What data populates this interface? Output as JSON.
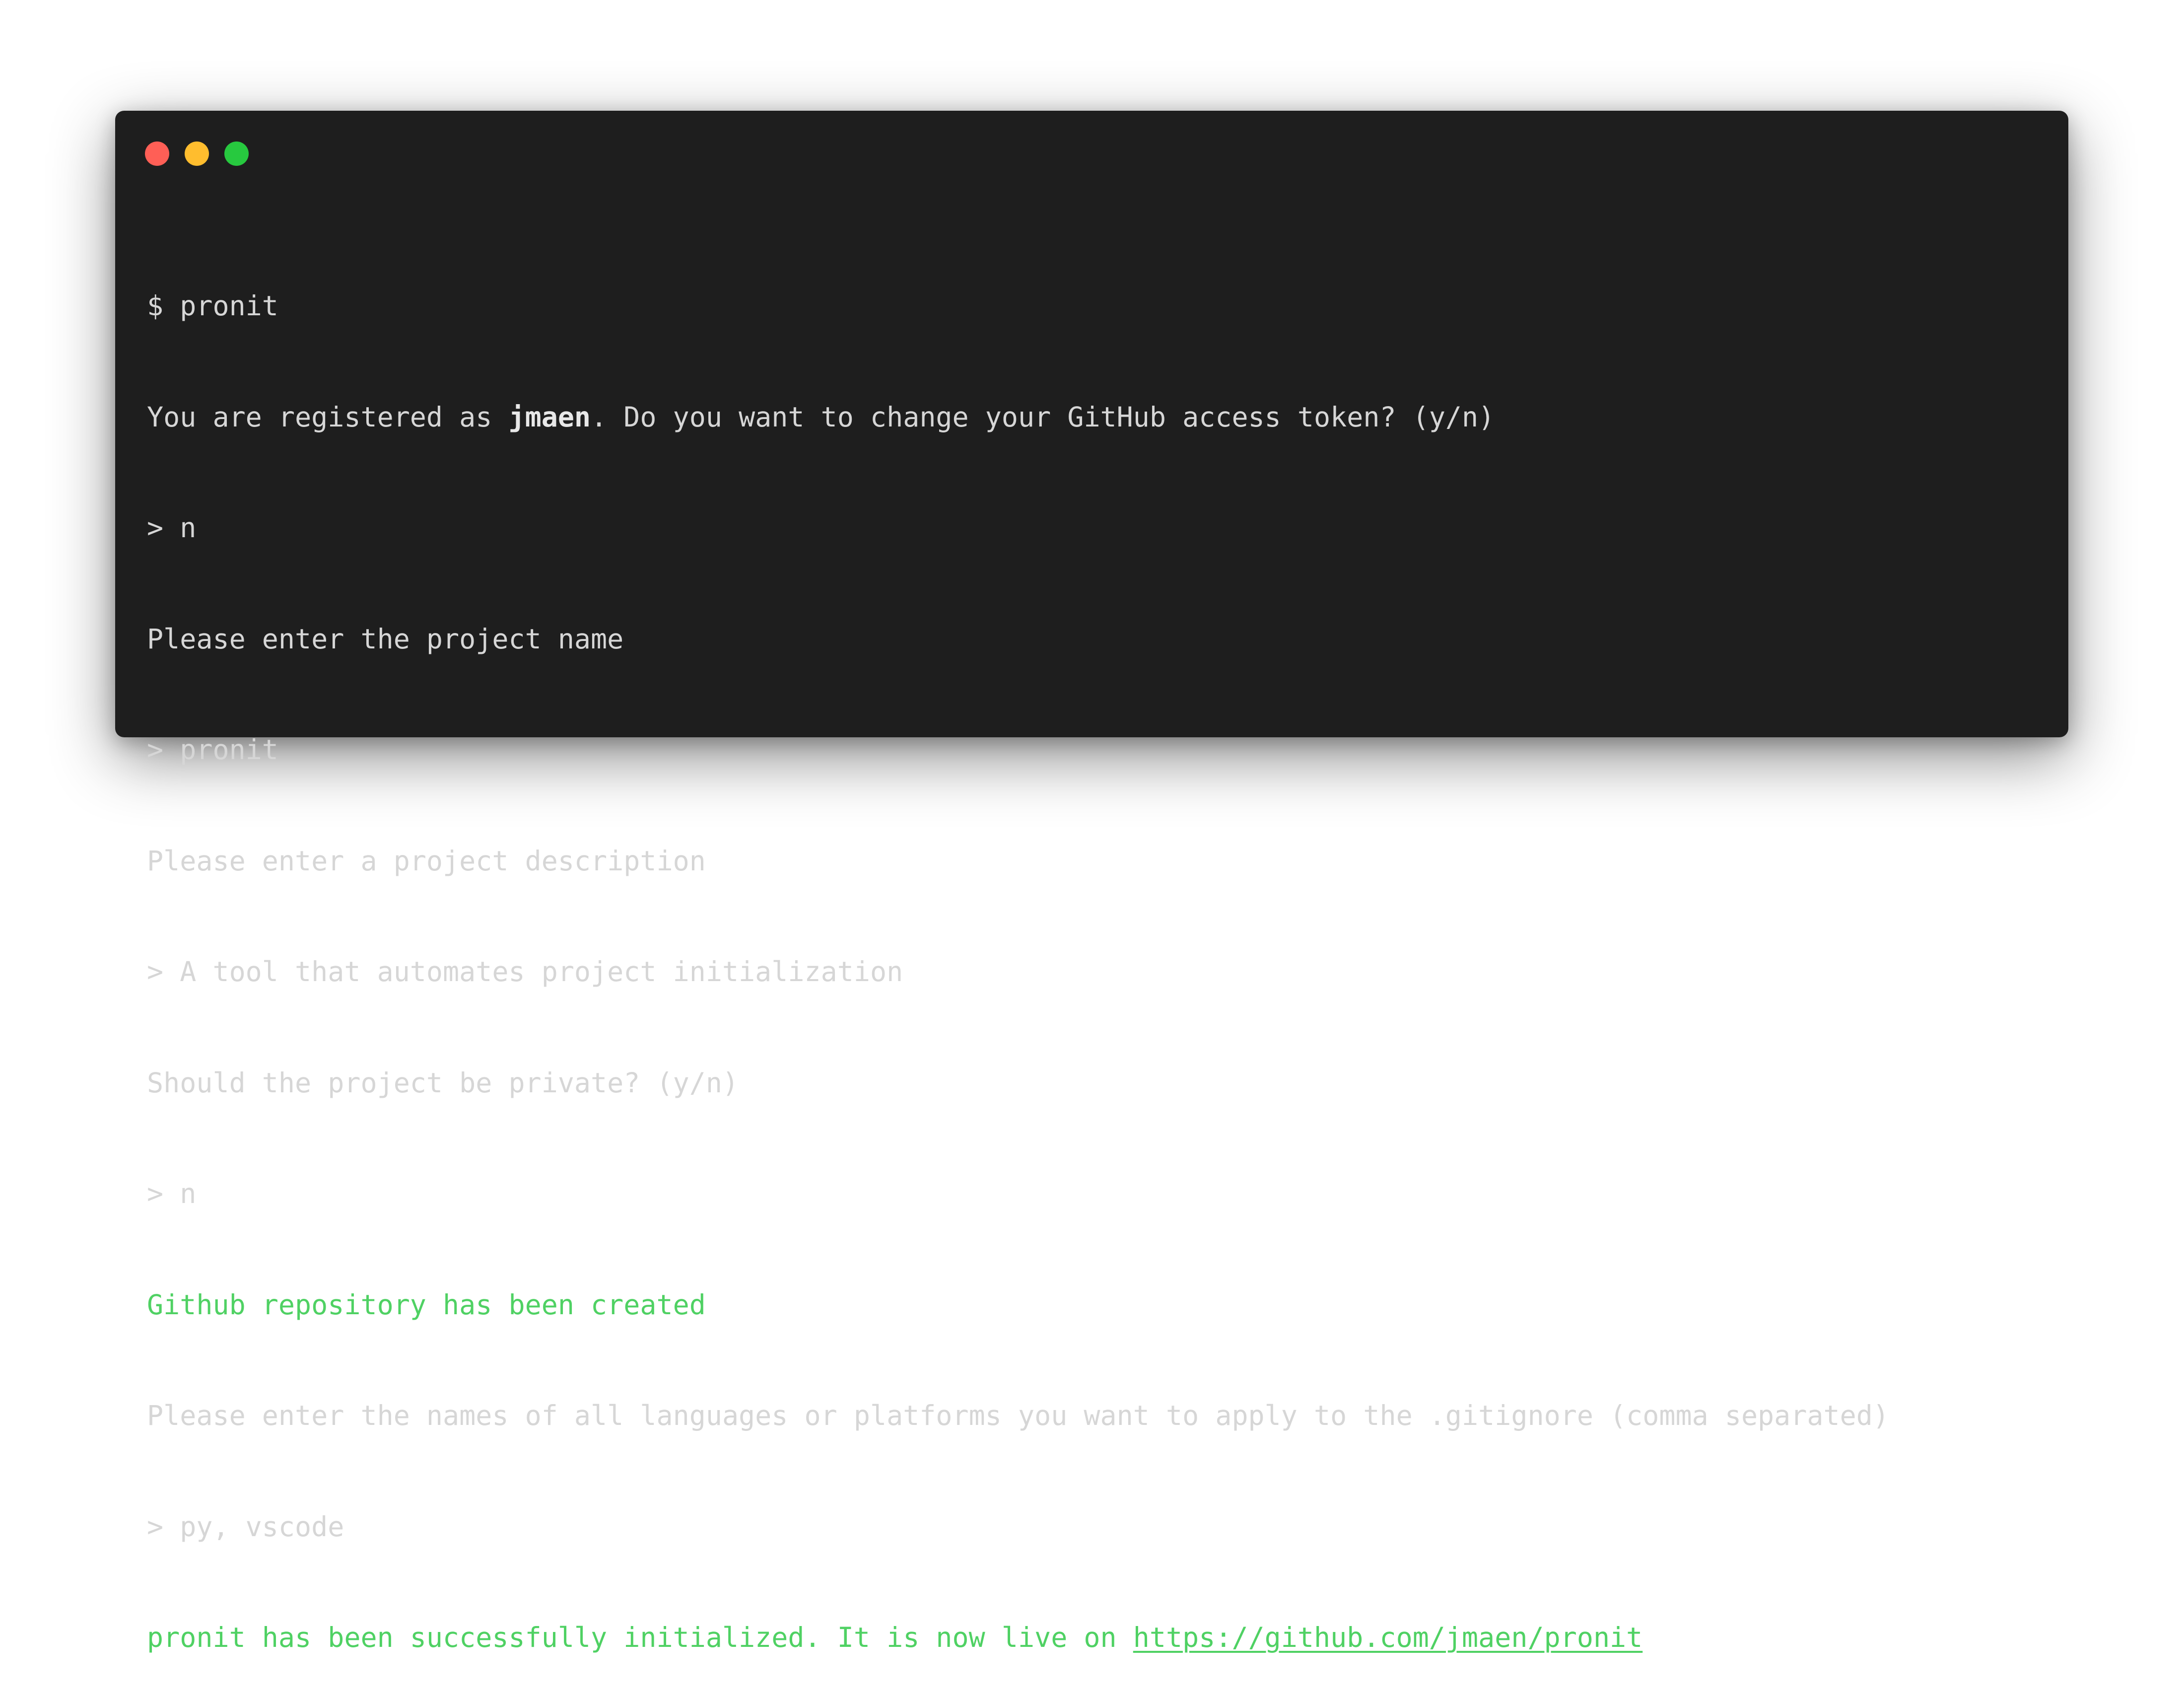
{
  "window": {
    "buttons": {
      "close": "close-button",
      "minimize": "minimize-button",
      "zoom": "zoom-button"
    },
    "colors": {
      "background": "#1e1e1e",
      "text": "#d6d6d6",
      "success": "#4fd163",
      "close": "#ff5f56",
      "minimize": "#ffbd2e",
      "zoom": "#27c93f"
    }
  },
  "terminal": {
    "line1": "$ pronit",
    "line2_before": "You are registered as ",
    "line2_user": "jmaen",
    "line2_after": ". Do you want to change your GitHub access token? (y/n)",
    "line3": "> n",
    "line4": "Please enter the project name",
    "line5": "> pronit",
    "line6": "Please enter a project description",
    "line7": "> A tool that automates project initialization",
    "line8": "Should the project be private? (y/n)",
    "line9": "> n",
    "line10": "Github repository has been created",
    "line11": "Please enter the names of all languages or platforms you want to apply to the .gitignore (comma separated)",
    "line12": "> py, vscode",
    "line13_text": "pronit has been successfully initialized. It is now live on ",
    "line13_link": "https://github.com/jmaen/pronit"
  }
}
